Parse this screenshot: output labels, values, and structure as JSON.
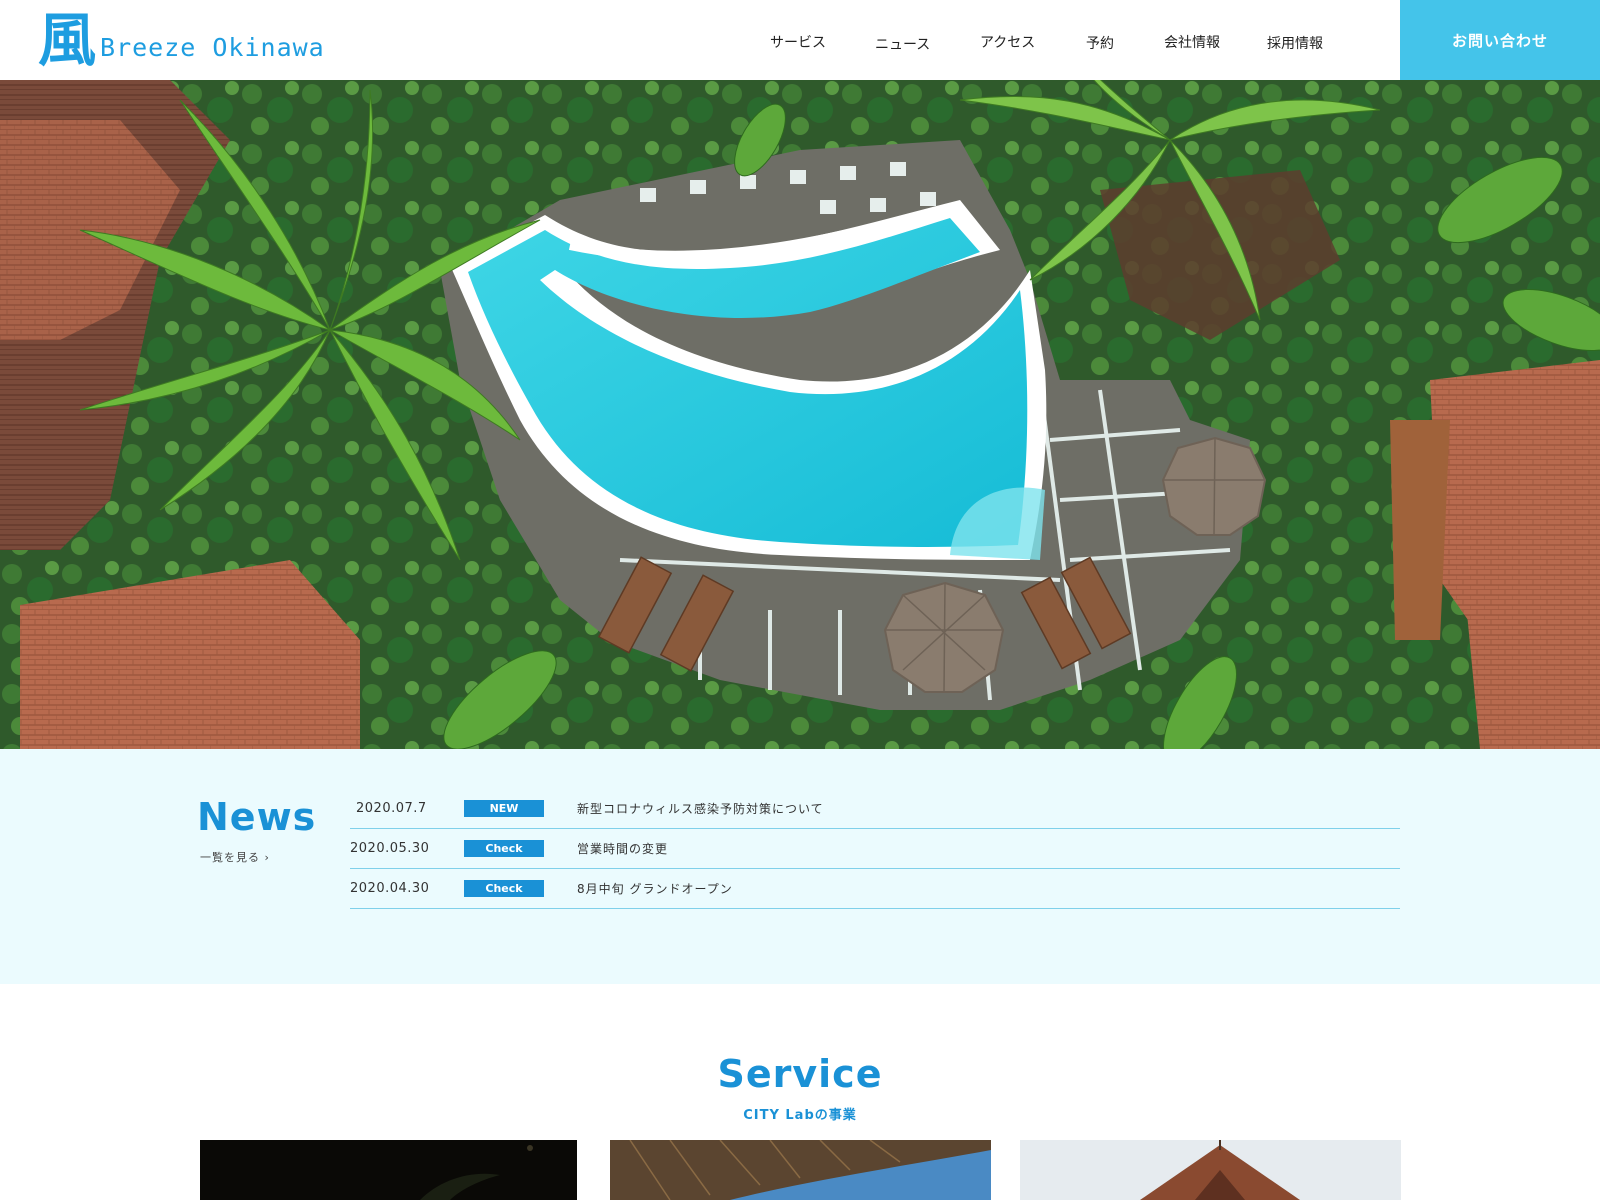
{
  "header": {
    "logo_mark": "風",
    "logo_text": "Breeze Okinawa",
    "nav": [
      {
        "label": "サービス"
      },
      {
        "label": "ニュース"
      },
      {
        "label": "アクセス"
      },
      {
        "label": "予約"
      },
      {
        "label": "会社情報"
      },
      {
        "label": "採用情報"
      }
    ],
    "contact_label": "お問い合わせ",
    "accent_color": "#44c4ea"
  },
  "hero": {
    "image": "aerial-tropical-resort-pool"
  },
  "news": {
    "title": "News",
    "more_label": "一覧を見る ›",
    "items": [
      {
        "date": "2020.07.7",
        "badge": "NEW",
        "text": "新型コロナウィルス感染予防対策について"
      },
      {
        "date": "2020.05.30",
        "badge": "Check",
        "text": "営業時間の変更"
      },
      {
        "date": "2020.04.30",
        "badge": "Check",
        "text": "8月中旬 グランドオープン"
      }
    ],
    "background": "#ebfbfe",
    "badge_color": "#1a91d6"
  },
  "service": {
    "title": "Service",
    "subtitle": "CITY Labの事業",
    "cards": [
      {
        "image": "night-palm-photo"
      },
      {
        "image": "thatched-roof-sky-photo"
      },
      {
        "image": "wooden-lodge-roof-photo"
      }
    ]
  }
}
